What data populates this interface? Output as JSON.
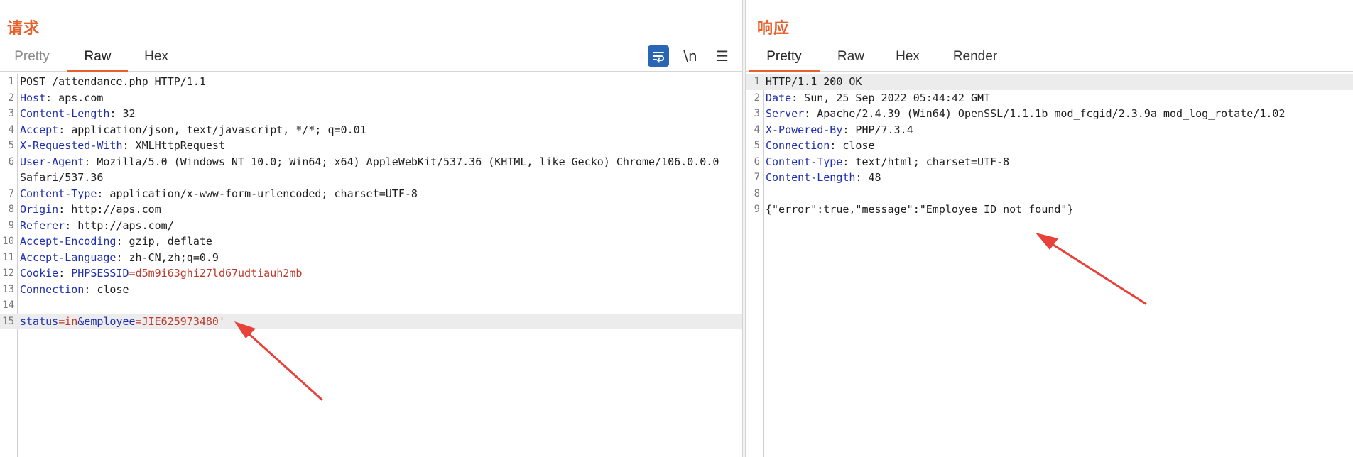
{
  "request": {
    "title": "请求",
    "tabs": [
      {
        "label": "Pretty"
      },
      {
        "label": "Raw"
      },
      {
        "label": "Hex"
      }
    ],
    "toolbar": {
      "wrap_icon": "word-wrap-icon",
      "newline_label": "\\n",
      "menu_icon": "hamburger-menu-icon"
    },
    "lines": {
      "l1": "POST /attendance.php HTTP/1.1",
      "l2k": "Host",
      "l2v": ": aps.com",
      "l3k": "Content-Length",
      "l3v": ": 32",
      "l4k": "Accept",
      "l4v": ": application/json, text/javascript, */*; q=0.01",
      "l5k": "X-Requested-With",
      "l5v": ": XMLHttpRequest",
      "l6k": "User-Agent",
      "l6v": ": Mozilla/5.0 (Windows NT 10.0; Win64; x64) AppleWebKit/537.36 (KHTML, like Gecko) Chrome/106.0.0.0",
      "l6cont": "Safari/537.36",
      "l7k": "Content-Type",
      "l7v": ": application/x-www-form-urlencoded; charset=UTF-8",
      "l8k": "Origin",
      "l8v": ": http://aps.com",
      "l9k": "Referer",
      "l9v": ": http://aps.com/",
      "l10k": "Accept-Encoding",
      "l10v": ": gzip, deflate",
      "l11k": "Accept-Language",
      "l11v": ": zh-CN,zh;q=0.9",
      "l12k": "Cookie",
      "l12sep": ": ",
      "l12ck": "PHPSESSID",
      "l12eq": "=",
      "l12cv": "d5m9i63ghi27ld67udtiauh2mb",
      "l13k": "Connection",
      "l13v": ": close",
      "l14": "",
      "l15k1": "status",
      "l15e1": "=",
      "l15v1": "in",
      "l15amp": "&",
      "l15k2": "employee",
      "l15e2": "=",
      "l15v2": "JIE625973480'"
    }
  },
  "response": {
    "title": "响应",
    "tabs": [
      {
        "label": "Pretty"
      },
      {
        "label": "Raw"
      },
      {
        "label": "Hex"
      },
      {
        "label": "Render"
      }
    ],
    "lines": {
      "l1": "HTTP/1.1 200 OK",
      "l2k": "Date",
      "l2v": ": Sun, 25 Sep 2022 05:44:42 GMT",
      "l3k": "Server",
      "l3v": ": Apache/2.4.39 (Win64) OpenSSL/1.1.1b mod_fcgid/2.3.9a mod_log_rotate/1.02",
      "l4k": "X-Powered-By",
      "l4v": ": PHP/7.3.4",
      "l5k": "Connection",
      "l5v": ": close",
      "l6k": "Content-Type",
      "l6v": ": text/html; charset=UTF-8",
      "l7k": "Content-Length",
      "l7v": ": 48",
      "l8": "",
      "l9": "{\"error\":true,\"message\":\"Employee ID not found\"}"
    }
  },
  "line_numbers": [
    "1",
    "2",
    "3",
    "4",
    "5",
    "6",
    "7",
    "8",
    "9",
    "10",
    "11",
    "12",
    "13",
    "14",
    "15"
  ],
  "colors": {
    "accent": "#e8602c",
    "header_key": "#1f2fb0",
    "param_value": "#c0392b",
    "annotation_arrow": "#e8413a",
    "wrap_button": "#2a66b3"
  }
}
